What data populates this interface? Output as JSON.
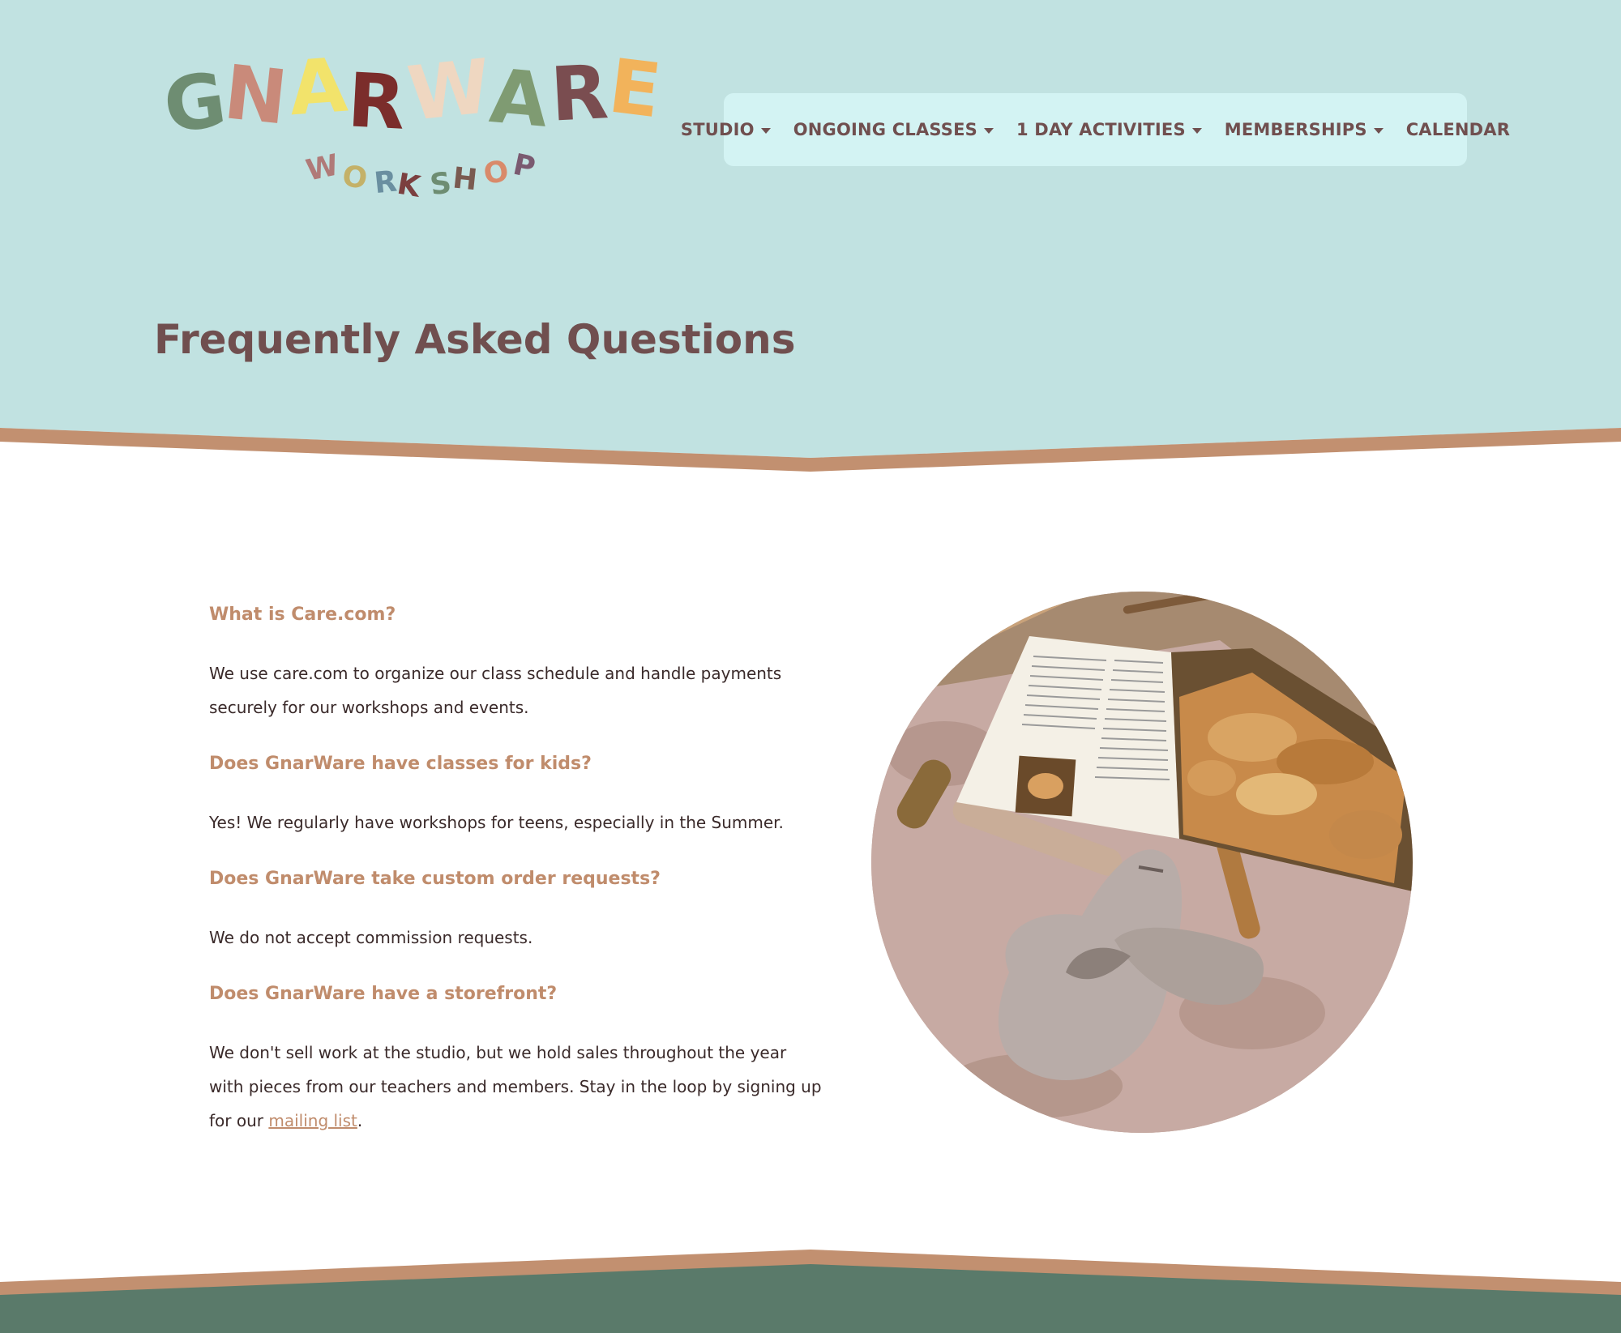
{
  "logo": {
    "main_letters": [
      {
        "ch": "G",
        "color": "#6e8d72"
      },
      {
        "ch": "N",
        "color": "#c98a7a"
      },
      {
        "ch": "A",
        "color": "#f2e36b"
      },
      {
        "ch": "R",
        "color": "#7b2d2b"
      },
      {
        "ch": "W",
        "color": "#efd7c1"
      },
      {
        "ch": "A",
        "color": "#7f9b72"
      },
      {
        "ch": "R",
        "color": "#7a4d50"
      },
      {
        "ch": "E",
        "color": "#f2b35b"
      }
    ],
    "sub_letters": [
      {
        "ch": "W",
        "color": "#b07a78"
      },
      {
        "ch": "O",
        "color": "#c4b168"
      },
      {
        "ch": "R",
        "color": "#6a8fa0"
      },
      {
        "ch": "K",
        "color": "#7b3f3f"
      },
      {
        "ch": "S",
        "color": "#6e8d72"
      },
      {
        "ch": "H",
        "color": "#7a5a50"
      },
      {
        "ch": "O",
        "color": "#d98a6a"
      },
      {
        "ch": "P",
        "color": "#7a5a70"
      }
    ]
  },
  "nav": {
    "items": [
      {
        "label": "STUDIO",
        "dropdown": true
      },
      {
        "label": "ONGOING CLASSES",
        "dropdown": true
      },
      {
        "label": "1 DAY ACTIVITIES",
        "dropdown": true
      },
      {
        "label": "MEMBERSHIPS",
        "dropdown": true
      },
      {
        "label": "CALENDAR",
        "dropdown": false
      }
    ]
  },
  "page": {
    "title": "Frequently Asked Questions"
  },
  "faq": [
    {
      "question": "What is Care.com?",
      "answer": "We use care.com to organize our class schedule and handle payments securely for our workshops and events."
    },
    {
      "question": "Does GnarWare have classes for kids?",
      "answer": "Yes! We regularly have workshops for teens, especially in the Summer."
    },
    {
      "question": "Does GnarWare take custom order requests?",
      "answer": "We do not accept commission requests."
    },
    {
      "question": "Does GnarWare have a storefront?",
      "answer_pre": "We don't sell work at the studio, but we hold sales throughout the year with pieces from our teachers and members. Stay in the loop by signing up for our ",
      "answer_link": "mailing list",
      "answer_post": "."
    }
  ],
  "colors": {
    "hero_bg": "#c1e2e1",
    "nav_bg": "#d3f3f3",
    "accent_band": "#c29070",
    "footer_bg": "#5a7a6a",
    "heading": "#704f4f",
    "question": "#c08c6c"
  }
}
